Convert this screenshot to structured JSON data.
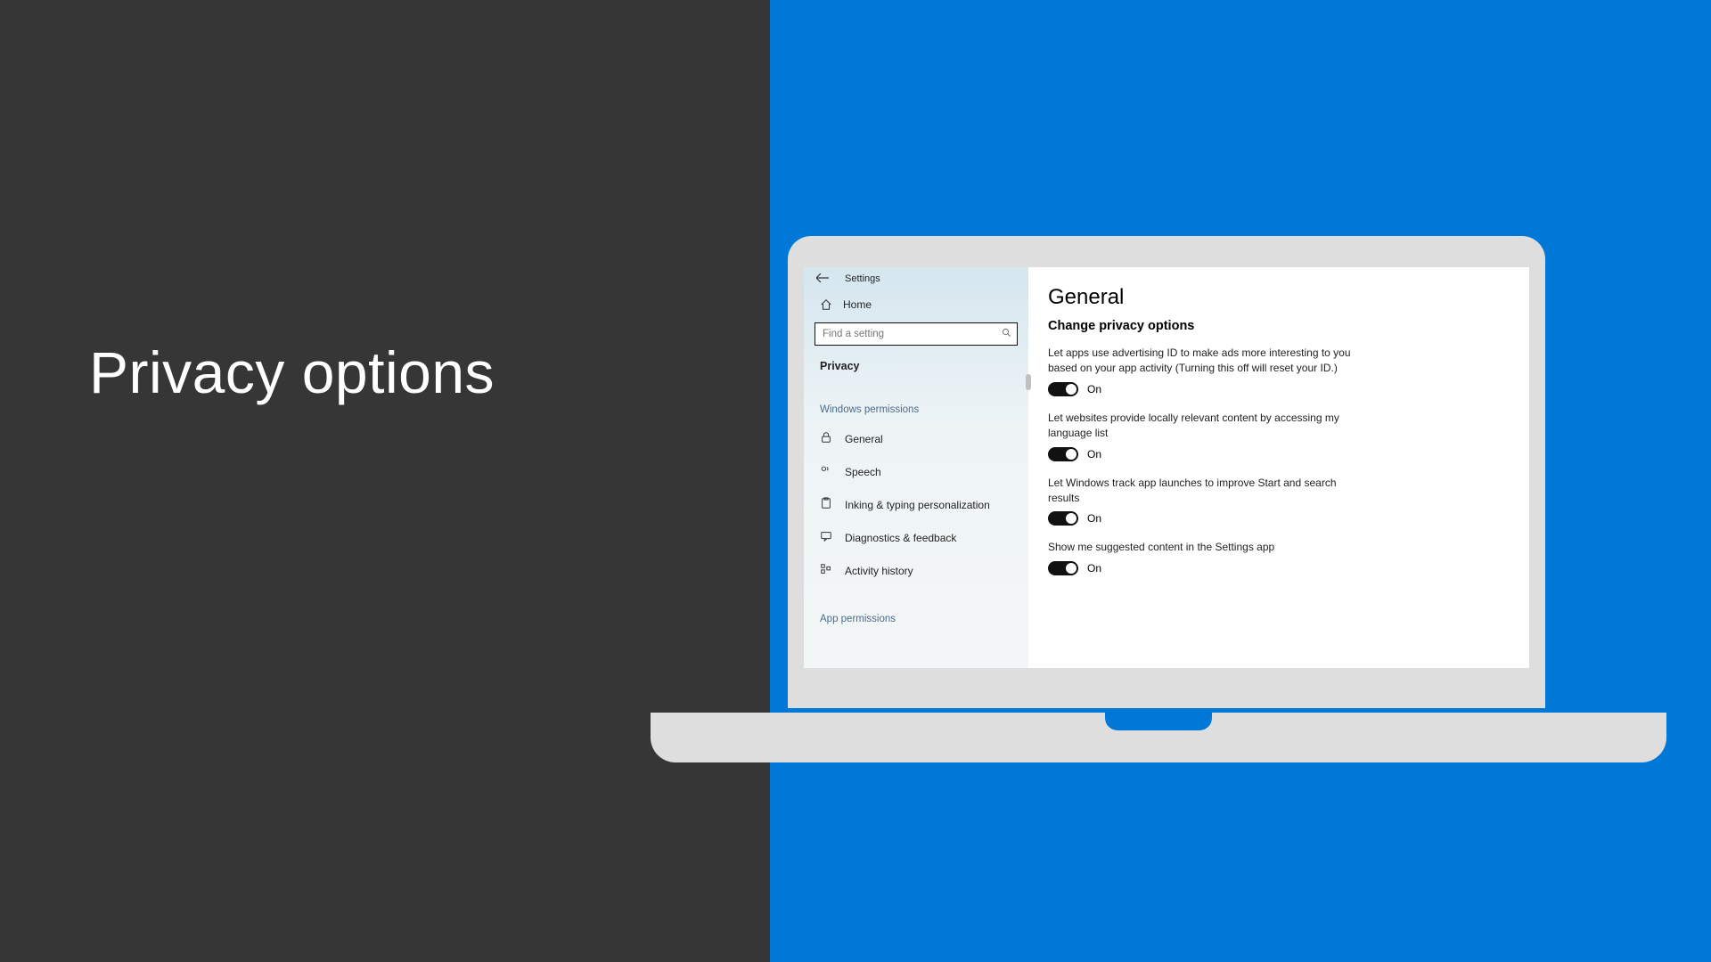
{
  "slide": {
    "title": "Privacy options"
  },
  "settings": {
    "app_title": "Settings",
    "home_label": "Home",
    "search_placeholder": "Find a setting",
    "current_section": "Privacy",
    "groups": {
      "windows_permissions": "Windows permissions",
      "app_permissions": "App permissions"
    },
    "nav": {
      "general": "General",
      "speech": "Speech",
      "inking": "Inking & typing personalization",
      "diagnostics": "Diagnostics & feedback",
      "activity": "Activity history"
    },
    "on_label": "On"
  },
  "page": {
    "title": "General",
    "subtitle": "Change privacy options",
    "options": [
      {
        "label": "Let apps use advertising ID to make ads more interesting to you based on your app activity (Turning this off will reset your ID.)",
        "state": "On"
      },
      {
        "label": "Let websites provide locally relevant content by accessing my language list",
        "state": "On"
      },
      {
        "label": "Let Windows track app launches to improve Start and search results",
        "state": "On"
      },
      {
        "label": "Show me suggested content in the Settings app",
        "state": "On"
      }
    ]
  }
}
